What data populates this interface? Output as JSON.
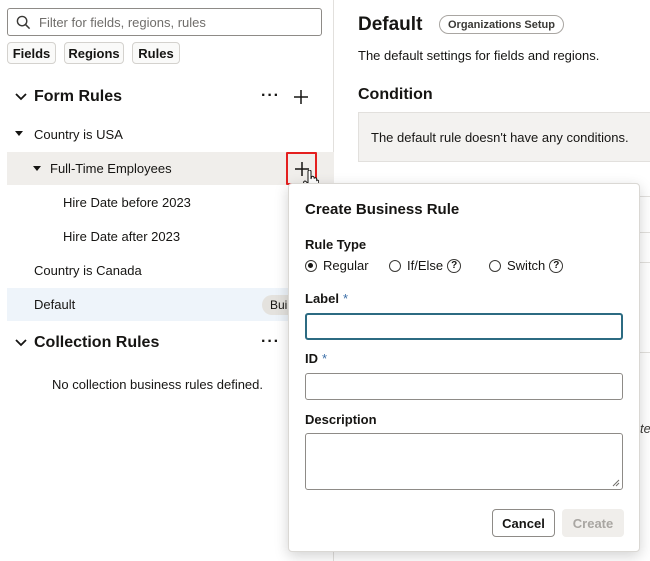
{
  "search": {
    "placeholder": "Filter for fields, regions, rules"
  },
  "chips": [
    "Fields",
    "Regions",
    "Rules"
  ],
  "form_rules": {
    "title": "Form Rules",
    "items": {
      "country_usa": "Country is USA",
      "full_time": "Full-Time Employees",
      "hire_before": "Hire Date before 2023",
      "hire_after": "Hire Date after 2023",
      "country_canada": "Country is Canada",
      "default": "Default",
      "default_badge": "Bui"
    }
  },
  "collection_rules": {
    "title": "Collection Rules",
    "empty": "No collection business rules defined."
  },
  "detail": {
    "title": "Default",
    "badge": "Organizations Setup",
    "description": "The default settings for fields and regions.",
    "condition_title": "Condition",
    "condition_text": "The default rule doesn't have any conditions.",
    "clipped_text": "te"
  },
  "dialog": {
    "title": "Create Business Rule",
    "rule_type_label": "Rule Type",
    "options": [
      "Regular",
      "If/Else",
      "Switch"
    ],
    "selected_option": "Regular",
    "label_label": "Label",
    "id_label": "ID",
    "required_mark": "*",
    "description_label": "Description",
    "cancel": "Cancel",
    "create": "Create",
    "help_glyph": "?"
  },
  "colors": {
    "highlight_row": "#eef4fa",
    "selected_row": "#f0eeeb",
    "focus_border": "#2c6b82",
    "red_outline": "#e41f1f"
  }
}
